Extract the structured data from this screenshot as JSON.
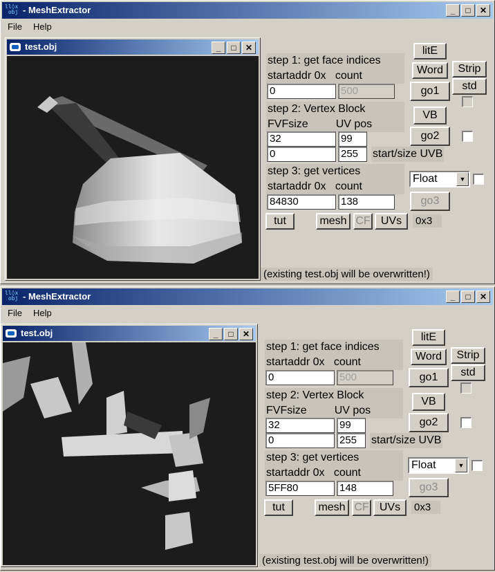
{
  "app": {
    "title": "MeshExtractor",
    "menu": [
      "File",
      "Help"
    ]
  },
  "child_title": "test.obj",
  "windows": [
    {
      "step1": {
        "label": "step 1: get face indices",
        "startaddr_label": "startaddr 0x",
        "count_label": "count",
        "startaddr": "0",
        "count": "500"
      },
      "step2": {
        "label": "step 2: Vertex Block",
        "fvf_label": "FVFsize",
        "uvpos_label": "UV pos",
        "fvf": "32",
        "uvpos": "99",
        "uvb_start": "0",
        "uvb_size": "255",
        "uvb_label": "start/size UVB"
      },
      "step3": {
        "label": "step 3: get vertices",
        "startaddr_label": "startaddr 0x",
        "count_label": "count",
        "startaddr": "84830",
        "count": "138",
        "format": "Float"
      },
      "buttons": {
        "lite": "litE",
        "word": "Word",
        "strip": "Strip",
        "std": "std",
        "go1": "go1",
        "vb": "VB",
        "go2": "go2",
        "go3": "go3",
        "tut": "tut",
        "mesh": "mesh",
        "cf": "CF",
        "uvs": "UVs"
      },
      "readout": "0x3",
      "warning": "(existing test.obj will be overwritten!)"
    },
    {
      "step1": {
        "label": "step 1: get face indices",
        "startaddr_label": "startaddr 0x",
        "count_label": "count",
        "startaddr": "0",
        "count": "500"
      },
      "step2": {
        "label": "step 2: Vertex Block",
        "fvf_label": "FVFsize",
        "uvpos_label": "UV pos",
        "fvf": "32",
        "uvpos": "99",
        "uvb_start": "0",
        "uvb_size": "255",
        "uvb_label": "start/size UVB"
      },
      "step3": {
        "label": "step 3: get vertices",
        "startaddr_label": "startaddr 0x",
        "count_label": "count",
        "startaddr": "5FF80",
        "count": "148",
        "format": "Float"
      },
      "buttons": {
        "lite": "litE",
        "word": "Word",
        "strip": "Strip",
        "std": "std",
        "go1": "go1",
        "vb": "VB",
        "go2": "go2",
        "go3": "go3",
        "tut": "tut",
        "mesh": "mesh",
        "cf": "CF",
        "uvs": "UVs"
      },
      "readout": "0x3",
      "warning": "(existing test.obj will be overwritten!)"
    }
  ],
  "icons": {
    "minimize": "minimize-icon",
    "maximize": "maximize-icon",
    "close": "close-icon",
    "dropdown": "chevron-down-icon"
  }
}
